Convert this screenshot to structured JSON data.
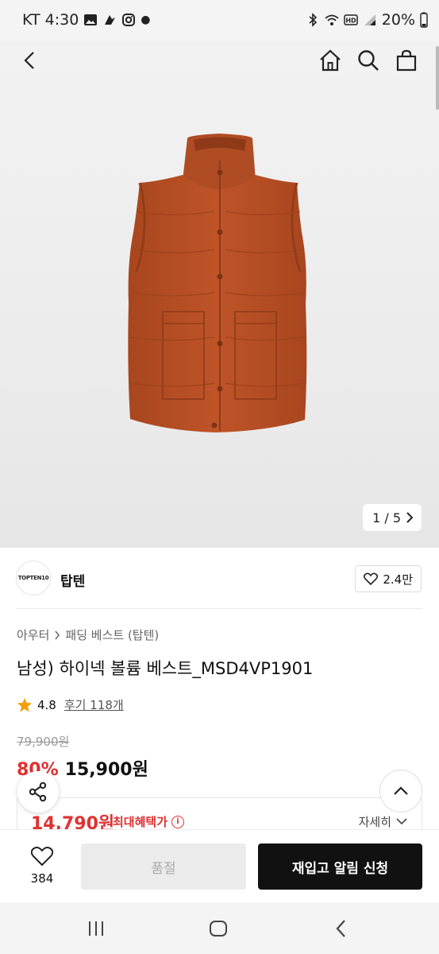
{
  "status_bar": {
    "carrier_time": "KT 4:30",
    "battery": "20%",
    "icons_left": [
      "gallery-icon",
      "bird-icon",
      "instagram-icon",
      "dot-icon"
    ],
    "icons_right": [
      "bluetooth-icon",
      "wifi-icon",
      "hd-icon",
      "signal-icon"
    ]
  },
  "top_nav": {
    "back": "back-icon",
    "home": "home-icon",
    "search": "search-icon",
    "cart": "shopping-bag-icon"
  },
  "gallery": {
    "pager_text": "1 / 5",
    "image_desc": "vest-image"
  },
  "store": {
    "logo_text": "TOPTEN10",
    "name": "탑텐",
    "likes": "2.4만"
  },
  "breadcrumb": {
    "level1": "아우터",
    "level2": "패딩 베스트 (탑텐)"
  },
  "product": {
    "title": "남성) 하이넥 볼륨 베스트_MSD4VP1901",
    "rating": "4.8",
    "reviews": "후기 118개",
    "original_price": "79,900원",
    "discount": "80%",
    "price": "15,900원",
    "benefit_price": "14,790원",
    "benefit_label": "최대혜택가",
    "detail_label": "자세히"
  },
  "bottom_bar": {
    "wish_count": "384",
    "soldout_label": "품절",
    "restock_label": "재입고 알림 신청"
  },
  "colors": {
    "accent_red": "#e03131",
    "star": "#f59f00",
    "vest": "#b84f25"
  }
}
